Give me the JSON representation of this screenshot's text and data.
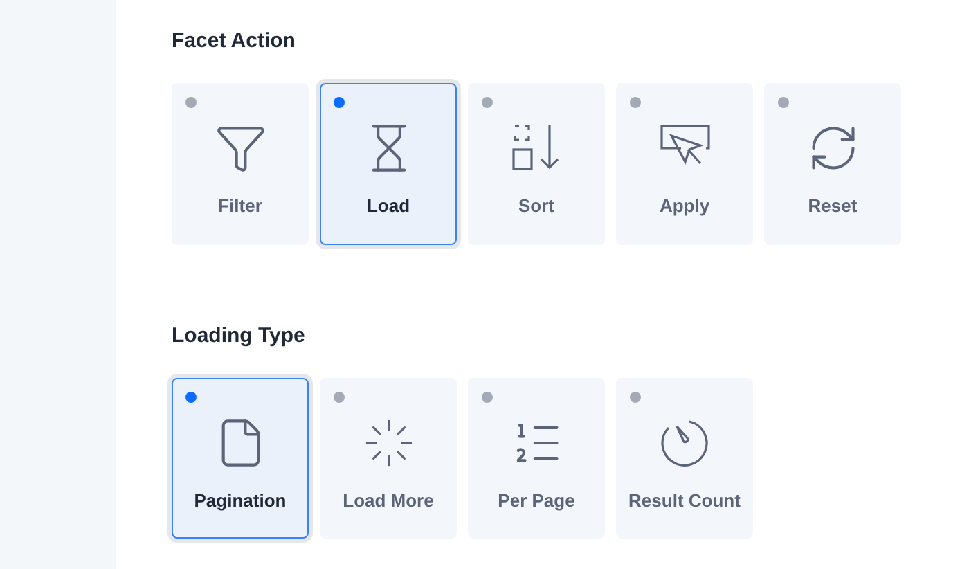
{
  "sections": [
    {
      "title": "Facet Action",
      "options": [
        {
          "label": "Filter",
          "selected": false
        },
        {
          "label": "Load",
          "selected": true
        },
        {
          "label": "Sort",
          "selected": false
        },
        {
          "label": "Apply",
          "selected": false
        },
        {
          "label": "Reset",
          "selected": false
        }
      ]
    },
    {
      "title": "Loading Type",
      "options": [
        {
          "label": "Pagination",
          "selected": true
        },
        {
          "label": "Load More",
          "selected": false
        },
        {
          "label": "Per Page",
          "selected": false
        },
        {
          "label": "Result Count",
          "selected": false
        }
      ]
    }
  ]
}
